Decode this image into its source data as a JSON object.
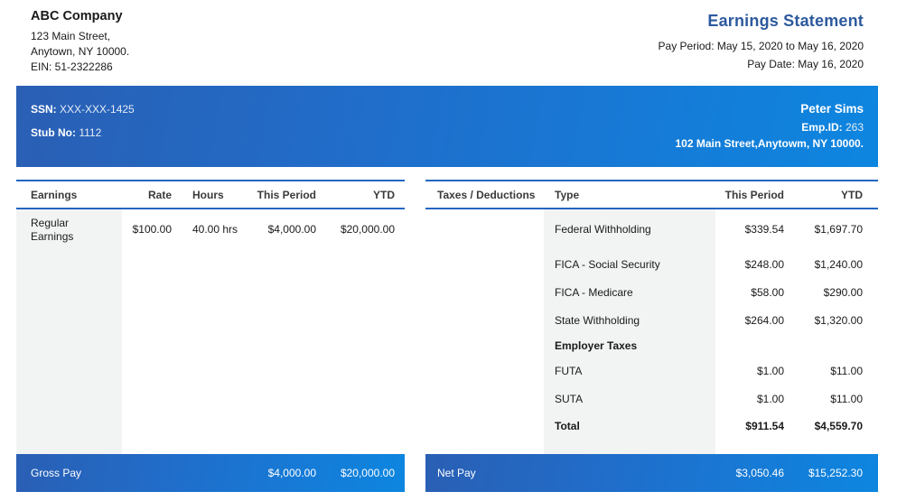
{
  "company": {
    "name": "ABC Company",
    "address_line1": "123 Main Street,",
    "address_line2": "Anytown, NY 10000.",
    "ein": "EIN: 51-2322286"
  },
  "statement": {
    "title": "Earnings Statement",
    "pay_period": "Pay Period: May 15, 2020 to May 16, 2020",
    "pay_date": "Pay Date: May 16, 2020"
  },
  "employee": {
    "ssn_label": "SSN:",
    "ssn_value": "XXX-XXX-1425",
    "stub_label": "Stub No:",
    "stub_value": "1112",
    "name": "Peter Sims",
    "emp_id_label": "Emp.ID:",
    "emp_id_value": "263",
    "address": "102 Main Street,Anytowm, NY 10000."
  },
  "earnings": {
    "headers": {
      "earnings": "Earnings",
      "rate": "Rate",
      "hours": "Hours",
      "this_period": "This Period",
      "ytd": "YTD"
    },
    "rows": [
      {
        "label_line1": "Regular",
        "label_line2": "Earnings",
        "rate": "$100.00",
        "hours": "40.00 hrs",
        "this_period": "$4,000.00",
        "ytd": "$20,000.00"
      }
    ],
    "footer": {
      "label": "Gross Pay",
      "this_period": "$4,000.00",
      "ytd": "$20,000.00"
    }
  },
  "deductions": {
    "headers": {
      "taxes": "Taxes / Deductions",
      "type": "Type",
      "this_period": "This Period",
      "ytd": "YTD"
    },
    "rows": [
      {
        "type": "Federal Withholding",
        "this_period": "$339.54",
        "ytd": "$1,697.70"
      },
      {
        "type": "FICA - Social Security",
        "this_period": "$248.00",
        "ytd": "$1,240.00"
      },
      {
        "type": "FICA - Medicare",
        "this_period": "$58.00",
        "ytd": "$290.00"
      },
      {
        "type": "State Withholding",
        "this_period": "$264.00",
        "ytd": "$1,320.00"
      }
    ],
    "employer_taxes_label": "Employer Taxes",
    "employer_rows": [
      {
        "type": "FUTA",
        "this_period": "$1.00",
        "ytd": "$11.00"
      },
      {
        "type": "SUTA",
        "this_period": "$1.00",
        "ytd": "$11.00"
      }
    ],
    "total": {
      "label": "Total",
      "this_period": "$911.54",
      "ytd": "$4,559.70"
    },
    "footer": {
      "label": "Net Pay",
      "this_period": "$3,050.46",
      "ytd": "$15,252.30"
    }
  },
  "colors": {
    "title_blue": "#2d5a9e",
    "band_blue_start": "#2a5fb4",
    "band_blue_end": "#0d86e0",
    "rule_blue": "#2466c4",
    "shade_gray": "#f2f3f3"
  }
}
